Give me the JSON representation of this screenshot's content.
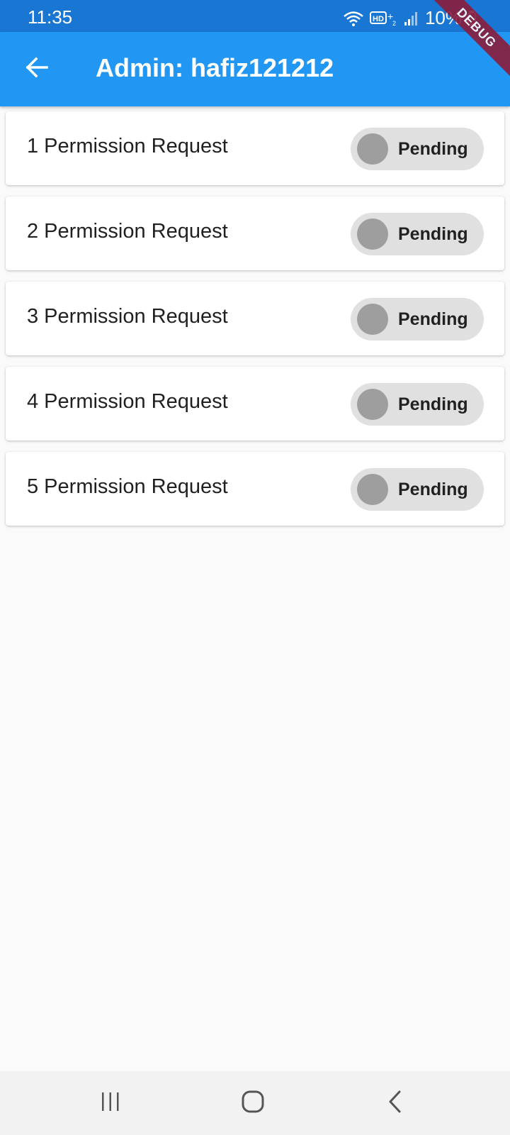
{
  "status_bar": {
    "time": "11:35",
    "battery": "10%"
  },
  "app_bar": {
    "title": "Admin: hafiz121212",
    "debug_banner": "DEBUG"
  },
  "requests": [
    {
      "label": "1 Permission Request",
      "status": "Pending"
    },
    {
      "label": "2 Permission Request",
      "status": "Pending"
    },
    {
      "label": "3 Permission Request",
      "status": "Pending"
    },
    {
      "label": "4 Permission Request",
      "status": "Pending"
    },
    {
      "label": "5 Permission Request",
      "status": "Pending"
    }
  ],
  "icons": {
    "back": "arrow-left-icon",
    "nav_recents": "recents-icon",
    "nav_home": "home-icon",
    "nav_back": "chevron-left-icon",
    "status": [
      "wifi-icon",
      "hd-voice-icon",
      "signal-icon",
      "battery-icon"
    ]
  },
  "colors": {
    "status_bar": "#1976d2",
    "app_bar": "#2196f3",
    "background": "#fafafa",
    "toggle_track": "#e0e0e0",
    "toggle_knob": "#9e9e9e",
    "debug_banner": "#8b1d3b"
  }
}
